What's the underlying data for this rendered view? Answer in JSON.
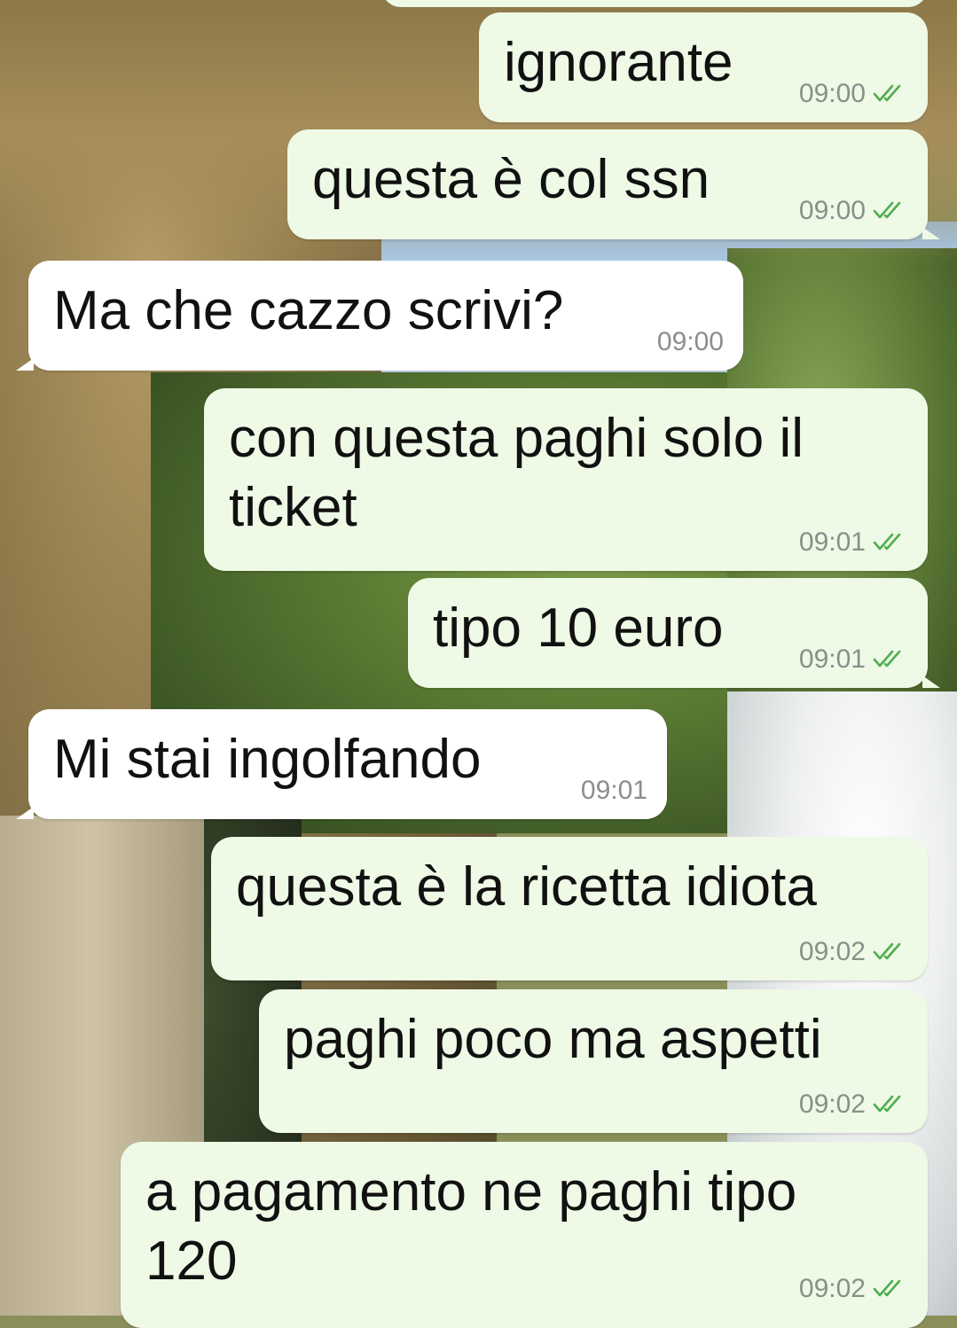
{
  "colors": {
    "outgoing_bubble": "#eef9e6",
    "incoming_bubble": "#ffffff",
    "read_tick": "#4fae4e",
    "time_text": "#8a8f8a"
  },
  "icons": {
    "read_receipt": "double-check-icon"
  },
  "messages": [
    {
      "direction": "out",
      "text": "ignorante",
      "time": "09:00",
      "read": true
    },
    {
      "direction": "out",
      "text": "questa è col ssn",
      "time": "09:00",
      "read": true
    },
    {
      "direction": "in",
      "text": "Ma che cazzo scrivi?",
      "time": "09:00"
    },
    {
      "direction": "out",
      "text": "con questa paghi solo il ticket",
      "time": "09:01",
      "read": true
    },
    {
      "direction": "out",
      "text": "tipo 10 euro",
      "time": "09:01",
      "read": true
    },
    {
      "direction": "in",
      "text": "Mi stai ingolfando",
      "time": "09:01"
    },
    {
      "direction": "out",
      "text": "questa è la ricetta idiota",
      "time": "09:02",
      "read": true
    },
    {
      "direction": "out",
      "text": "paghi poco ma aspetti",
      "time": "09:02",
      "read": true
    },
    {
      "direction": "out",
      "text": "a pagamento ne paghi tipo 120",
      "time": "09:02",
      "read": true
    }
  ]
}
